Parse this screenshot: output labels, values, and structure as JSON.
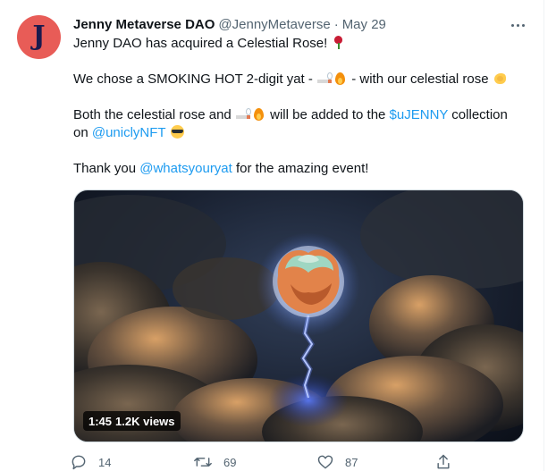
{
  "tweet": {
    "avatar_letter": "J",
    "display_name": "Jenny Metaverse DAO",
    "handle": "@JennyMetaverse",
    "separator": "·",
    "date": "May 29",
    "line1": "Jenny DAO has acquired a Celestial Rose!",
    "line2_before": "We chose a SMOKING HOT 2-digit yat - ",
    "line2_after": " - with our celestial rose",
    "line3_before": "Both the celestial rose and ",
    "line3_middle": " will be added to the ",
    "line3_link": "$uJENNY",
    "line3_after": " collection",
    "line4_before": "on ",
    "line4_link": "@uniclyNFT",
    "line5_before": "Thank you ",
    "line5_link": "@whatsyouryat",
    "line5_after": " for the amazing event!",
    "emoji_names": [
      "rose-emoji",
      "cigarette-emoji",
      "fire-emoji",
      "flexed-biceps-emoji",
      "smiling-face-with-sunglasses-emoji"
    ]
  },
  "media": {
    "duration": "1:45",
    "views": "1.2K views"
  },
  "actions": {
    "replies": "14",
    "retweets": "69",
    "likes": "87"
  },
  "colors": {
    "link": "#1d9bf0",
    "secondary_text": "#536471",
    "avatar_bg": "#e85c57"
  }
}
